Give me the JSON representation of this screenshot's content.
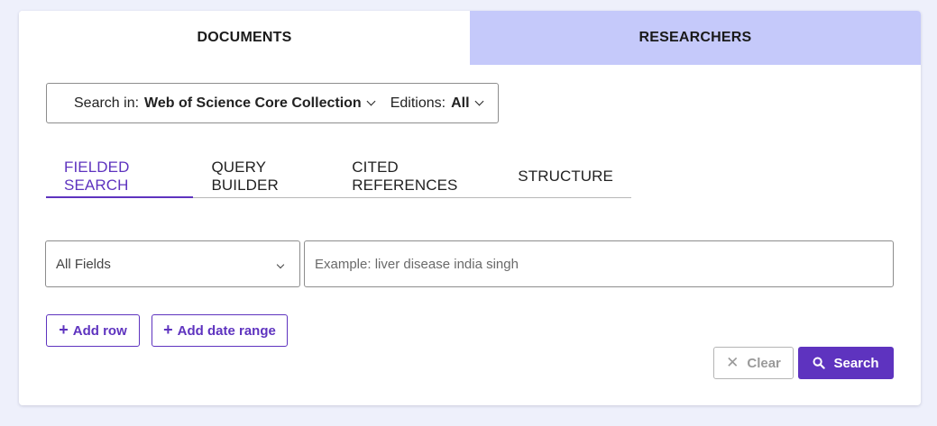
{
  "top_tabs": [
    {
      "label": "DOCUMENTS",
      "active": true
    },
    {
      "label": "RESEARCHERS",
      "active": false
    }
  ],
  "scope": {
    "search_in_label": "Search in:",
    "search_in_value": "Web of Science Core Collection",
    "editions_label": "Editions:",
    "editions_value": "All"
  },
  "search_tabs": [
    {
      "label": "FIELDED SEARCH",
      "active": true
    },
    {
      "label": "QUERY BUILDER",
      "active": false
    },
    {
      "label": "CITED REFERENCES",
      "active": false
    },
    {
      "label": "STRUCTURE",
      "active": false
    }
  ],
  "field_select": {
    "value": "All Fields",
    "icon": "chevron-down-icon"
  },
  "query_input": {
    "value": "",
    "placeholder": "Example: liver disease india singh"
  },
  "actions": {
    "add_row_label": "Add row",
    "add_date_range_label": "Add date range",
    "clear_label": "Clear",
    "search_label": "Search"
  },
  "icons": {
    "add": "plus-icon",
    "clear": "close-icon",
    "search": "search-icon"
  },
  "colors": {
    "accent": "#5e33bf",
    "inactive_tab_bg": "#c5c9fa",
    "page_bg": "#eef0fb"
  }
}
